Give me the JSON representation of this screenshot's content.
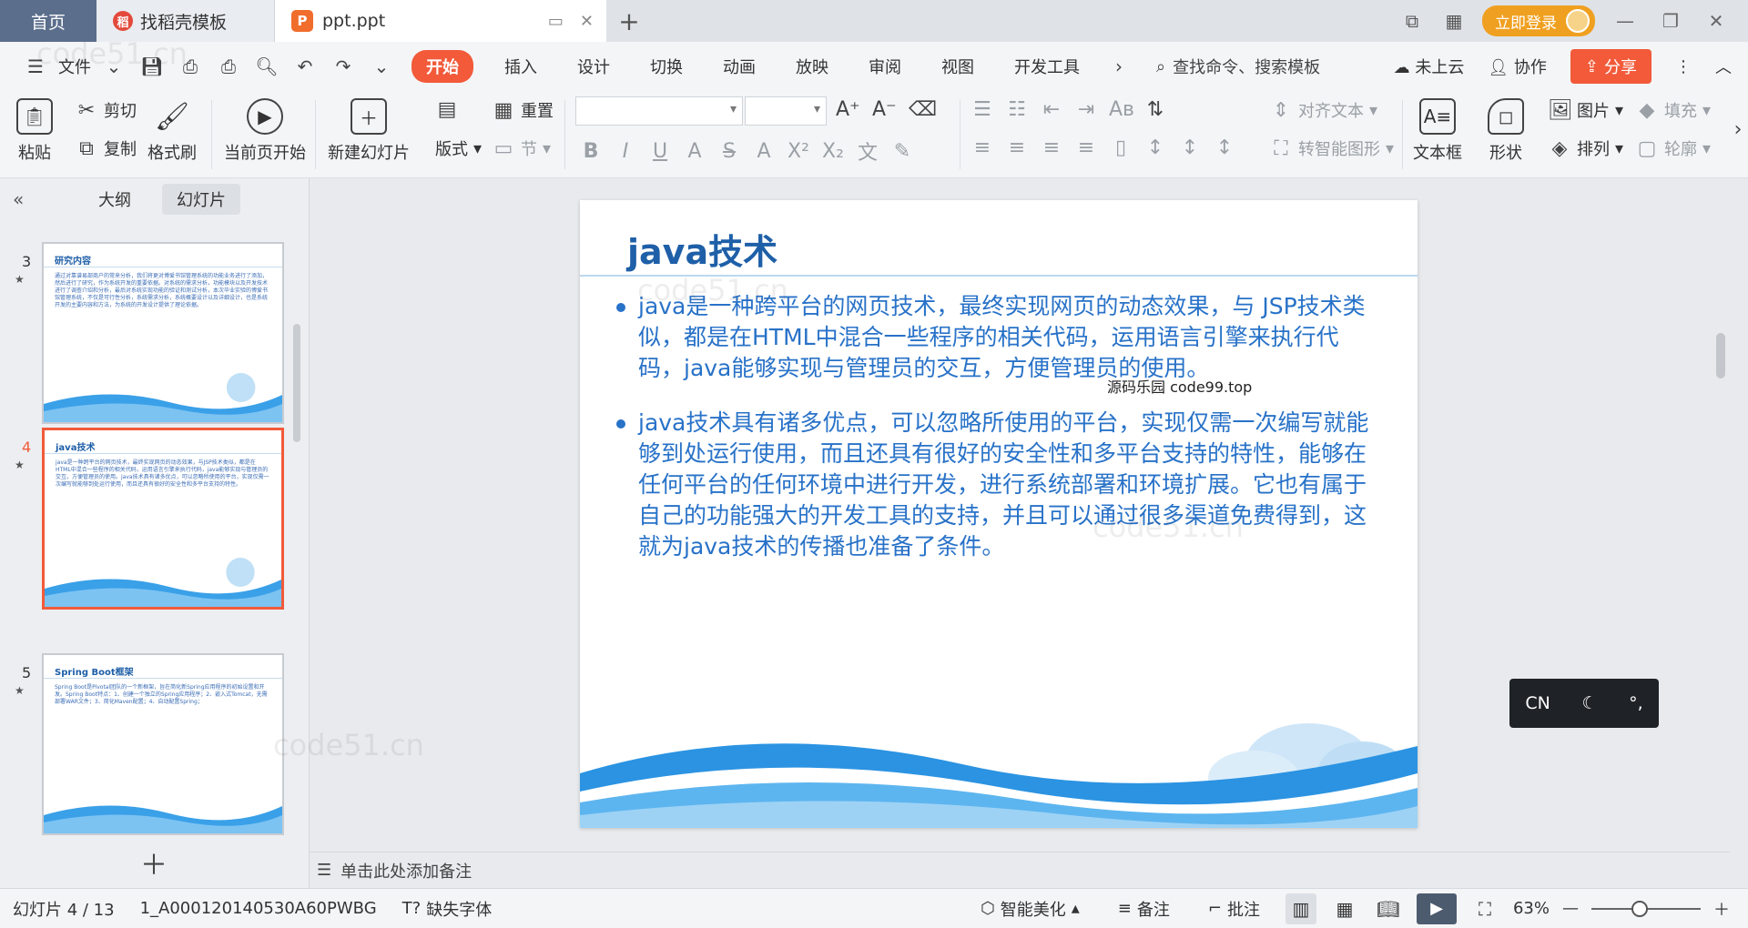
{
  "tabs": {
    "home": "首页",
    "daoke": "找稻壳模板",
    "file": "ppt.ppt"
  },
  "titlebar": {
    "login": "立即登录"
  },
  "menu": {
    "file": "文件",
    "items": [
      "开始",
      "插入",
      "设计",
      "切换",
      "动画",
      "放映",
      "审阅",
      "视图",
      "开发工具"
    ],
    "search": "查找命令、搜索模板",
    "cloud": "未上云",
    "collab": "协作",
    "share": "分享"
  },
  "ribbon": {
    "paste": "粘贴",
    "cut": "剪切",
    "copy": "复制",
    "format_painter": "格式刷",
    "from_current": "当前页开始",
    "new_slide": "新建幻灯片",
    "layout": "版式",
    "section": "节",
    "reset": "重置",
    "align_text": "对齐文本",
    "smartart": "转智能图形",
    "textbox": "文本框",
    "shape": "形状",
    "picture": "图片",
    "arrange": "排列",
    "fill": "填充",
    "outline": "轮廓"
  },
  "panel": {
    "outline_tab": "大纲",
    "slides_tab": "幻灯片",
    "thumbs": [
      {
        "num": "3",
        "title": "研究内容",
        "text": "通过对靠谱易部商户的常来分析，我们将更对博爱书馆管理系统的功能业务进行了添加，然后进行了研究，作为系统开发的重要依据。对系统的需求分析，功能模块以及开发技术进行了调查介绍和分析，最后对系统实现功能的验证和测试分析，本次毕业实验的博爱书馆管理系统，不仅是可行性分析，系统需求分析，系统概要设计以及详细设计，也是系统开发的主要内容和方法，为系统的开发设计提供了理论依据。"
      },
      {
        "num": "4",
        "title": "java技术",
        "text": "java是一种跨平台的网页技术，最终实现网页的动态效果，与JSP技术类似，都是在HTML中混合一些程序的相关代码，运用语言引擎来执行代码，java能够实现与管理员的交互，方便管理员的使用。java技术具有诸多优点，可以忽略所使用的平台，实现仅需一次编写就能够到处运行使用，而且还具有很好的安全性和多平台支持的特性。"
      },
      {
        "num": "5",
        "title": "Spring Boot框架",
        "text": "Spring Boot是Pivotal团队的一个新框架，旨在简化新Spring应用程序的初始设置和开发。Spring Boot特点：1、创建一个独立的Spring应用程序；2、嵌入式Tomcat，无需部署WAR文件；3、简化Maven配置；4、自动配置Spring；"
      }
    ]
  },
  "slide": {
    "title": "java技术",
    "bullets": [
      "java是一种跨平台的网页技术，最终实现网页的动态效果，与 JSP技术类似，都是在HTML中混合一些程序的相关代码，运用语言引擎来执行代码，java能够实现与管理员的交互，方便管理员的使用。",
      "java技术具有诸多优点，可以忽略所使用的平台，实现仅需一次编写就能够到处运行使用，而且还具有很好的安全性和多平台支持的特性，能够在任何平台的任何环境中进行开发，进行系统部署和环境扩展。它也有属于自己的功能强大的开发工具的支持，并且可以通过很多渠道免费得到，这就为java技术的传播也准备了条件。"
    ],
    "overlay": "源码乐园 code99.top"
  },
  "notes": "单击此处添加备注",
  "ime": {
    "lang": "CN"
  },
  "status": {
    "slide_counter": "幻灯片 4 / 13",
    "template": "1_A000120140530A60PWBG",
    "missing_font": "缺失字体",
    "beautify": "智能美化",
    "notes": "备注",
    "comment": "批注",
    "zoom": "63%"
  },
  "watermark": "code51.cn"
}
